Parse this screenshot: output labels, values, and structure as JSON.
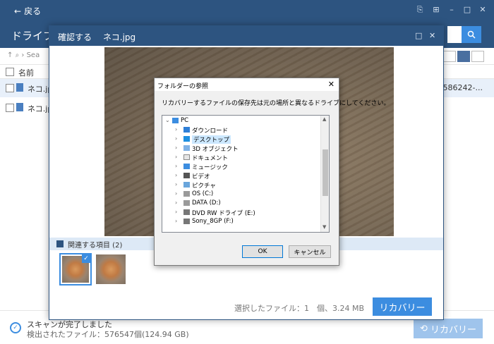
{
  "app": {
    "back_label": "戻る",
    "title": "ドライブ（",
    "breadcrumb": "Sea",
    "list_header": "名前",
    "rows": [
      {
        "name": "ネコ.jp",
        "extra": "586242-..."
      },
      {
        "name": "ネコ.jp",
        "extra": ""
      }
    ],
    "status_line1": "スキャンが完了しました",
    "status_line2": "検出されたファイル：576547個(124.94 GB)",
    "recover_label": "リカバリー"
  },
  "confirm": {
    "title": "確認する",
    "filename": "ネコ.jpg",
    "related_label": "関連する項目 (2)",
    "selected_info": "選択したファイル：1　個、3.24 MB",
    "recover_label": "リカバリー"
  },
  "folder_dialog": {
    "title": "フォルダーの参照",
    "message": "リカバリーするファイルの保存先は元の場所と異なるドライブにしてください。",
    "tree": [
      {
        "label": "PC",
        "icon": "pc-icon",
        "level": 0,
        "expanded": true
      },
      {
        "label": "ダウンロード",
        "icon": "download-icon",
        "level": 1
      },
      {
        "label": "デスクトップ",
        "icon": "desktop-icon",
        "level": 1,
        "selected": true
      },
      {
        "label": "3D オブジェクト",
        "icon": "3d-objects-icon",
        "level": 1
      },
      {
        "label": "ドキュメント",
        "icon": "document-icon",
        "level": 1
      },
      {
        "label": "ミュージック",
        "icon": "music-icon",
        "level": 1
      },
      {
        "label": "ビデオ",
        "icon": "video-icon",
        "level": 1
      },
      {
        "label": "ピクチャ",
        "icon": "picture-icon",
        "level": 1
      },
      {
        "label": "OS (C:)",
        "icon": "drive-icon",
        "level": 1
      },
      {
        "label": "DATA (D:)",
        "icon": "drive-icon",
        "level": 1
      },
      {
        "label": "DVD RW ドライブ (E:)",
        "icon": "dvd-drive-icon",
        "level": 1
      },
      {
        "label": "Sony_8GP (F:)",
        "icon": "usb-drive-icon",
        "level": 1
      }
    ],
    "ok_label": "OK",
    "cancel_label": "キャンセル"
  },
  "colors": {
    "header": "#2d5480",
    "accent": "#3c8de0",
    "disabled_accent": "#9fc4ec"
  }
}
